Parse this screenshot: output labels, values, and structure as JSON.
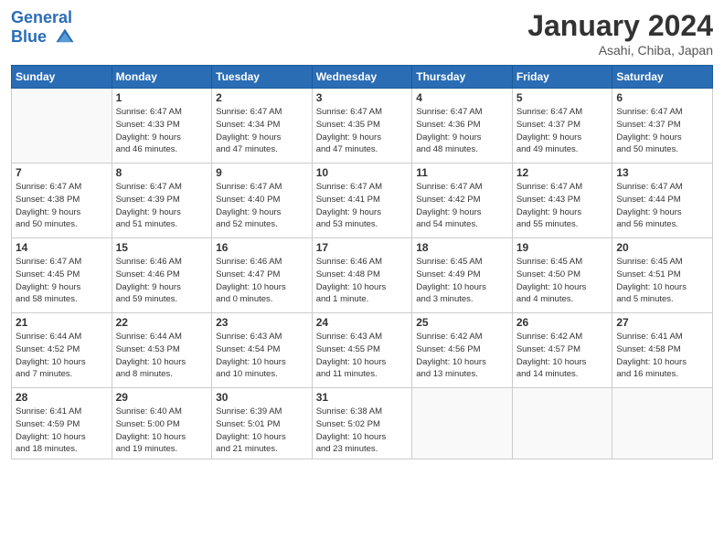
{
  "header": {
    "logo_line1": "General",
    "logo_line2": "Blue",
    "title": "January 2024",
    "subtitle": "Asahi, Chiba, Japan"
  },
  "weekdays": [
    "Sunday",
    "Monday",
    "Tuesday",
    "Wednesday",
    "Thursday",
    "Friday",
    "Saturday"
  ],
  "weeks": [
    [
      {
        "day": "",
        "info": ""
      },
      {
        "day": "1",
        "info": "Sunrise: 6:47 AM\nSunset: 4:33 PM\nDaylight: 9 hours\nand 46 minutes."
      },
      {
        "day": "2",
        "info": "Sunrise: 6:47 AM\nSunset: 4:34 PM\nDaylight: 9 hours\nand 47 minutes."
      },
      {
        "day": "3",
        "info": "Sunrise: 6:47 AM\nSunset: 4:35 PM\nDaylight: 9 hours\nand 47 minutes."
      },
      {
        "day": "4",
        "info": "Sunrise: 6:47 AM\nSunset: 4:36 PM\nDaylight: 9 hours\nand 48 minutes."
      },
      {
        "day": "5",
        "info": "Sunrise: 6:47 AM\nSunset: 4:37 PM\nDaylight: 9 hours\nand 49 minutes."
      },
      {
        "day": "6",
        "info": "Sunrise: 6:47 AM\nSunset: 4:37 PM\nDaylight: 9 hours\nand 50 minutes."
      }
    ],
    [
      {
        "day": "7",
        "info": "Sunrise: 6:47 AM\nSunset: 4:38 PM\nDaylight: 9 hours\nand 50 minutes."
      },
      {
        "day": "8",
        "info": "Sunrise: 6:47 AM\nSunset: 4:39 PM\nDaylight: 9 hours\nand 51 minutes."
      },
      {
        "day": "9",
        "info": "Sunrise: 6:47 AM\nSunset: 4:40 PM\nDaylight: 9 hours\nand 52 minutes."
      },
      {
        "day": "10",
        "info": "Sunrise: 6:47 AM\nSunset: 4:41 PM\nDaylight: 9 hours\nand 53 minutes."
      },
      {
        "day": "11",
        "info": "Sunrise: 6:47 AM\nSunset: 4:42 PM\nDaylight: 9 hours\nand 54 minutes."
      },
      {
        "day": "12",
        "info": "Sunrise: 6:47 AM\nSunset: 4:43 PM\nDaylight: 9 hours\nand 55 minutes."
      },
      {
        "day": "13",
        "info": "Sunrise: 6:47 AM\nSunset: 4:44 PM\nDaylight: 9 hours\nand 56 minutes."
      }
    ],
    [
      {
        "day": "14",
        "info": "Sunrise: 6:47 AM\nSunset: 4:45 PM\nDaylight: 9 hours\nand 58 minutes."
      },
      {
        "day": "15",
        "info": "Sunrise: 6:46 AM\nSunset: 4:46 PM\nDaylight: 9 hours\nand 59 minutes."
      },
      {
        "day": "16",
        "info": "Sunrise: 6:46 AM\nSunset: 4:47 PM\nDaylight: 10 hours\nand 0 minutes."
      },
      {
        "day": "17",
        "info": "Sunrise: 6:46 AM\nSunset: 4:48 PM\nDaylight: 10 hours\nand 1 minute."
      },
      {
        "day": "18",
        "info": "Sunrise: 6:45 AM\nSunset: 4:49 PM\nDaylight: 10 hours\nand 3 minutes."
      },
      {
        "day": "19",
        "info": "Sunrise: 6:45 AM\nSunset: 4:50 PM\nDaylight: 10 hours\nand 4 minutes."
      },
      {
        "day": "20",
        "info": "Sunrise: 6:45 AM\nSunset: 4:51 PM\nDaylight: 10 hours\nand 5 minutes."
      }
    ],
    [
      {
        "day": "21",
        "info": "Sunrise: 6:44 AM\nSunset: 4:52 PM\nDaylight: 10 hours\nand 7 minutes."
      },
      {
        "day": "22",
        "info": "Sunrise: 6:44 AM\nSunset: 4:53 PM\nDaylight: 10 hours\nand 8 minutes."
      },
      {
        "day": "23",
        "info": "Sunrise: 6:43 AM\nSunset: 4:54 PM\nDaylight: 10 hours\nand 10 minutes."
      },
      {
        "day": "24",
        "info": "Sunrise: 6:43 AM\nSunset: 4:55 PM\nDaylight: 10 hours\nand 11 minutes."
      },
      {
        "day": "25",
        "info": "Sunrise: 6:42 AM\nSunset: 4:56 PM\nDaylight: 10 hours\nand 13 minutes."
      },
      {
        "day": "26",
        "info": "Sunrise: 6:42 AM\nSunset: 4:57 PM\nDaylight: 10 hours\nand 14 minutes."
      },
      {
        "day": "27",
        "info": "Sunrise: 6:41 AM\nSunset: 4:58 PM\nDaylight: 10 hours\nand 16 minutes."
      }
    ],
    [
      {
        "day": "28",
        "info": "Sunrise: 6:41 AM\nSunset: 4:59 PM\nDaylight: 10 hours\nand 18 minutes."
      },
      {
        "day": "29",
        "info": "Sunrise: 6:40 AM\nSunset: 5:00 PM\nDaylight: 10 hours\nand 19 minutes."
      },
      {
        "day": "30",
        "info": "Sunrise: 6:39 AM\nSunset: 5:01 PM\nDaylight: 10 hours\nand 21 minutes."
      },
      {
        "day": "31",
        "info": "Sunrise: 6:38 AM\nSunset: 5:02 PM\nDaylight: 10 hours\nand 23 minutes."
      },
      {
        "day": "",
        "info": ""
      },
      {
        "day": "",
        "info": ""
      },
      {
        "day": "",
        "info": ""
      }
    ]
  ]
}
